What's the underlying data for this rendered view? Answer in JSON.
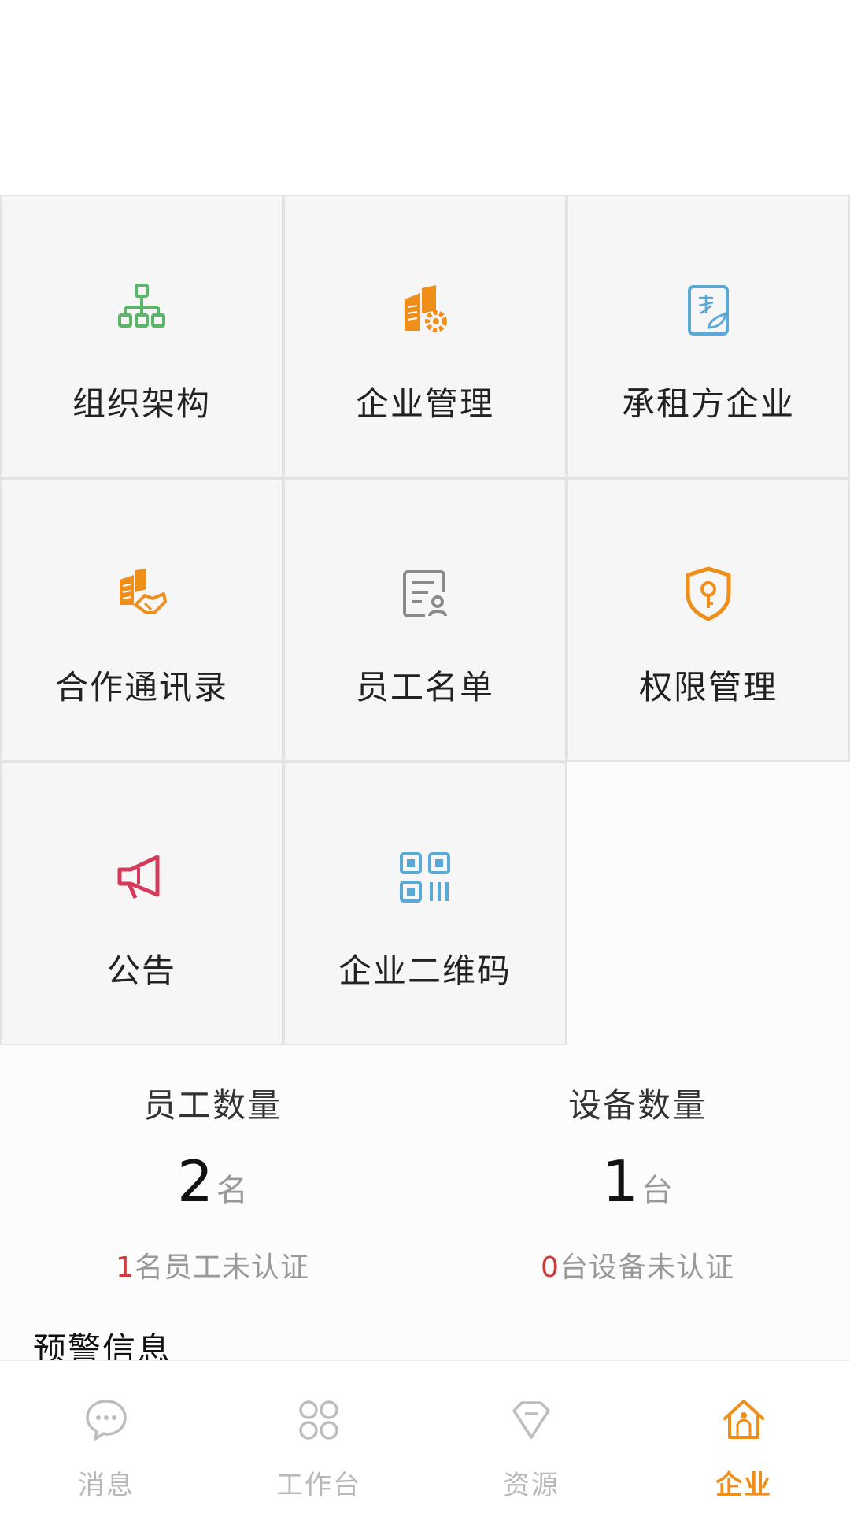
{
  "grid": {
    "items": [
      {
        "label": "组织架构",
        "icon": "org-chart-icon"
      },
      {
        "label": "企业管理",
        "icon": "building-gear-icon"
      },
      {
        "label": "承租方企业",
        "icon": "contract-document-icon"
      },
      {
        "label": "合作通讯录",
        "icon": "handshake-building-icon"
      },
      {
        "label": "员工名单",
        "icon": "employee-list-icon"
      },
      {
        "label": "权限管理",
        "icon": "shield-key-icon"
      },
      {
        "label": "公告",
        "icon": "megaphone-icon"
      },
      {
        "label": "企业二维码",
        "icon": "qr-code-icon"
      }
    ]
  },
  "stats": {
    "employees": {
      "title": "员工数量",
      "count": "2",
      "unit": "名",
      "unverified_count": "1",
      "unverified_text": "名员工未认证"
    },
    "devices": {
      "title": "设备数量",
      "count": "1",
      "unit": "台",
      "unverified_count": "0",
      "unverified_text": "台设备未认证"
    }
  },
  "warning": {
    "title": "预警信息"
  },
  "tabbar": {
    "items": [
      {
        "label": "消息",
        "icon": "chat-bubble-icon"
      },
      {
        "label": "工作台",
        "icon": "grid-circles-icon"
      },
      {
        "label": "资源",
        "icon": "diamond-icon"
      },
      {
        "label": "企业",
        "icon": "home-icon"
      }
    ],
    "active_index": 3
  },
  "colors": {
    "accent": "#f08e1a",
    "green": "#5cb56b",
    "blue": "#5aa8d6",
    "red": "#d63a5a",
    "gray": "#8a8a8a",
    "alert": "#cc3a3a"
  }
}
